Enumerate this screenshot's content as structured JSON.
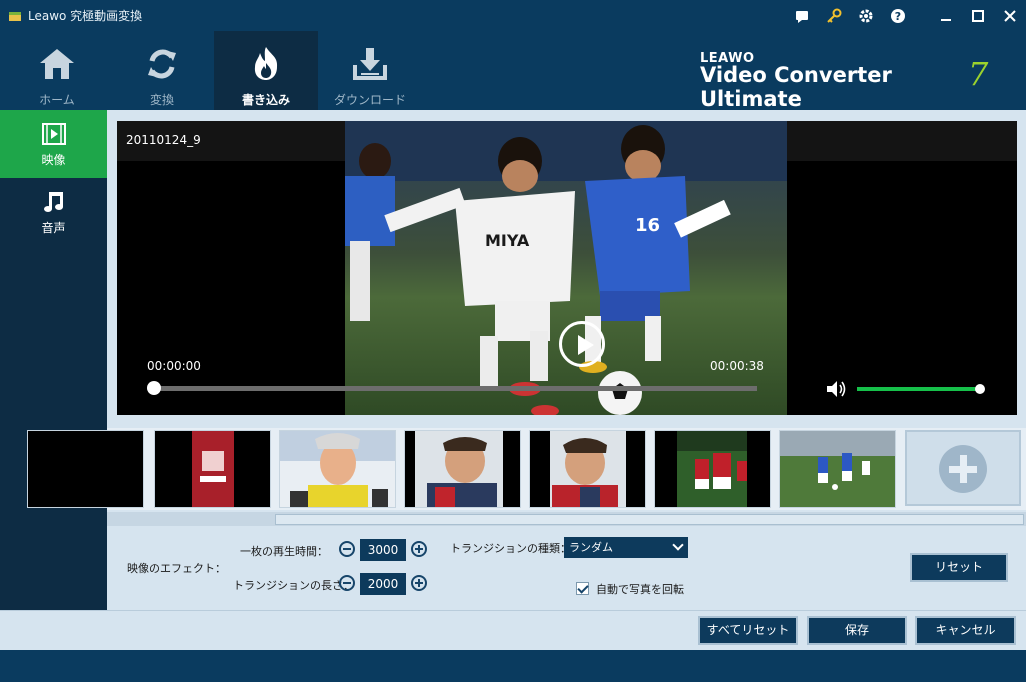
{
  "window": {
    "title": "Leawo 究極動画変換",
    "icons": [
      "feedback-icon",
      "key-icon",
      "gear-icon",
      "help-icon",
      "minimize-icon",
      "maximize-icon",
      "close-icon"
    ]
  },
  "nav": {
    "items": [
      {
        "label": "ホーム",
        "icon": "home-icon"
      },
      {
        "label": "変換",
        "icon": "convert-icon"
      },
      {
        "label": "書き込み",
        "icon": "burn-icon",
        "active": true
      },
      {
        "label": "ダウンロード",
        "icon": "download-icon"
      }
    ]
  },
  "brand": {
    "top": "LEAWO",
    "main": "Video Converter Ultimate",
    "version": "7"
  },
  "sidebar": {
    "items": [
      {
        "label": "映像",
        "icon": "video-icon",
        "active": true
      },
      {
        "label": "音声",
        "icon": "music-icon"
      }
    ]
  },
  "preview": {
    "clip_name": "20110124_9",
    "time_current": "00:00:00",
    "time_total": "00:00:38",
    "progress": 0,
    "volume": 1.0
  },
  "filmstrip": {
    "thumbs": [
      "thumb-1",
      "thumb-2",
      "thumb-3",
      "thumb-4",
      "thumb-5",
      "thumb-6",
      "thumb-7"
    ],
    "add_icon": "plus-icon"
  },
  "settings": {
    "effect_label": "映像のエフェクト：",
    "duration_label": "一枚の再生時間：",
    "duration_value": "3000",
    "transition_length_label": "トランジションの長さ：",
    "transition_length_value": "2000",
    "transition_type_label": "トランジションの種類：",
    "transition_type_value": "ランダム",
    "auto_rotate_label": "自動で写真を回転",
    "auto_rotate_checked": true,
    "reset_label": "リセット"
  },
  "footer": {
    "reset_all_label": "すべてリセット",
    "save_label": "保存",
    "cancel_label": "キャンセル"
  },
  "colors": {
    "nav_bg": "#0a3b5f",
    "active_green": "#1ea64a",
    "panel_bg": "#d6e4ef",
    "button_bg": "#0d3a5c",
    "version_green": "#9bd22d"
  }
}
